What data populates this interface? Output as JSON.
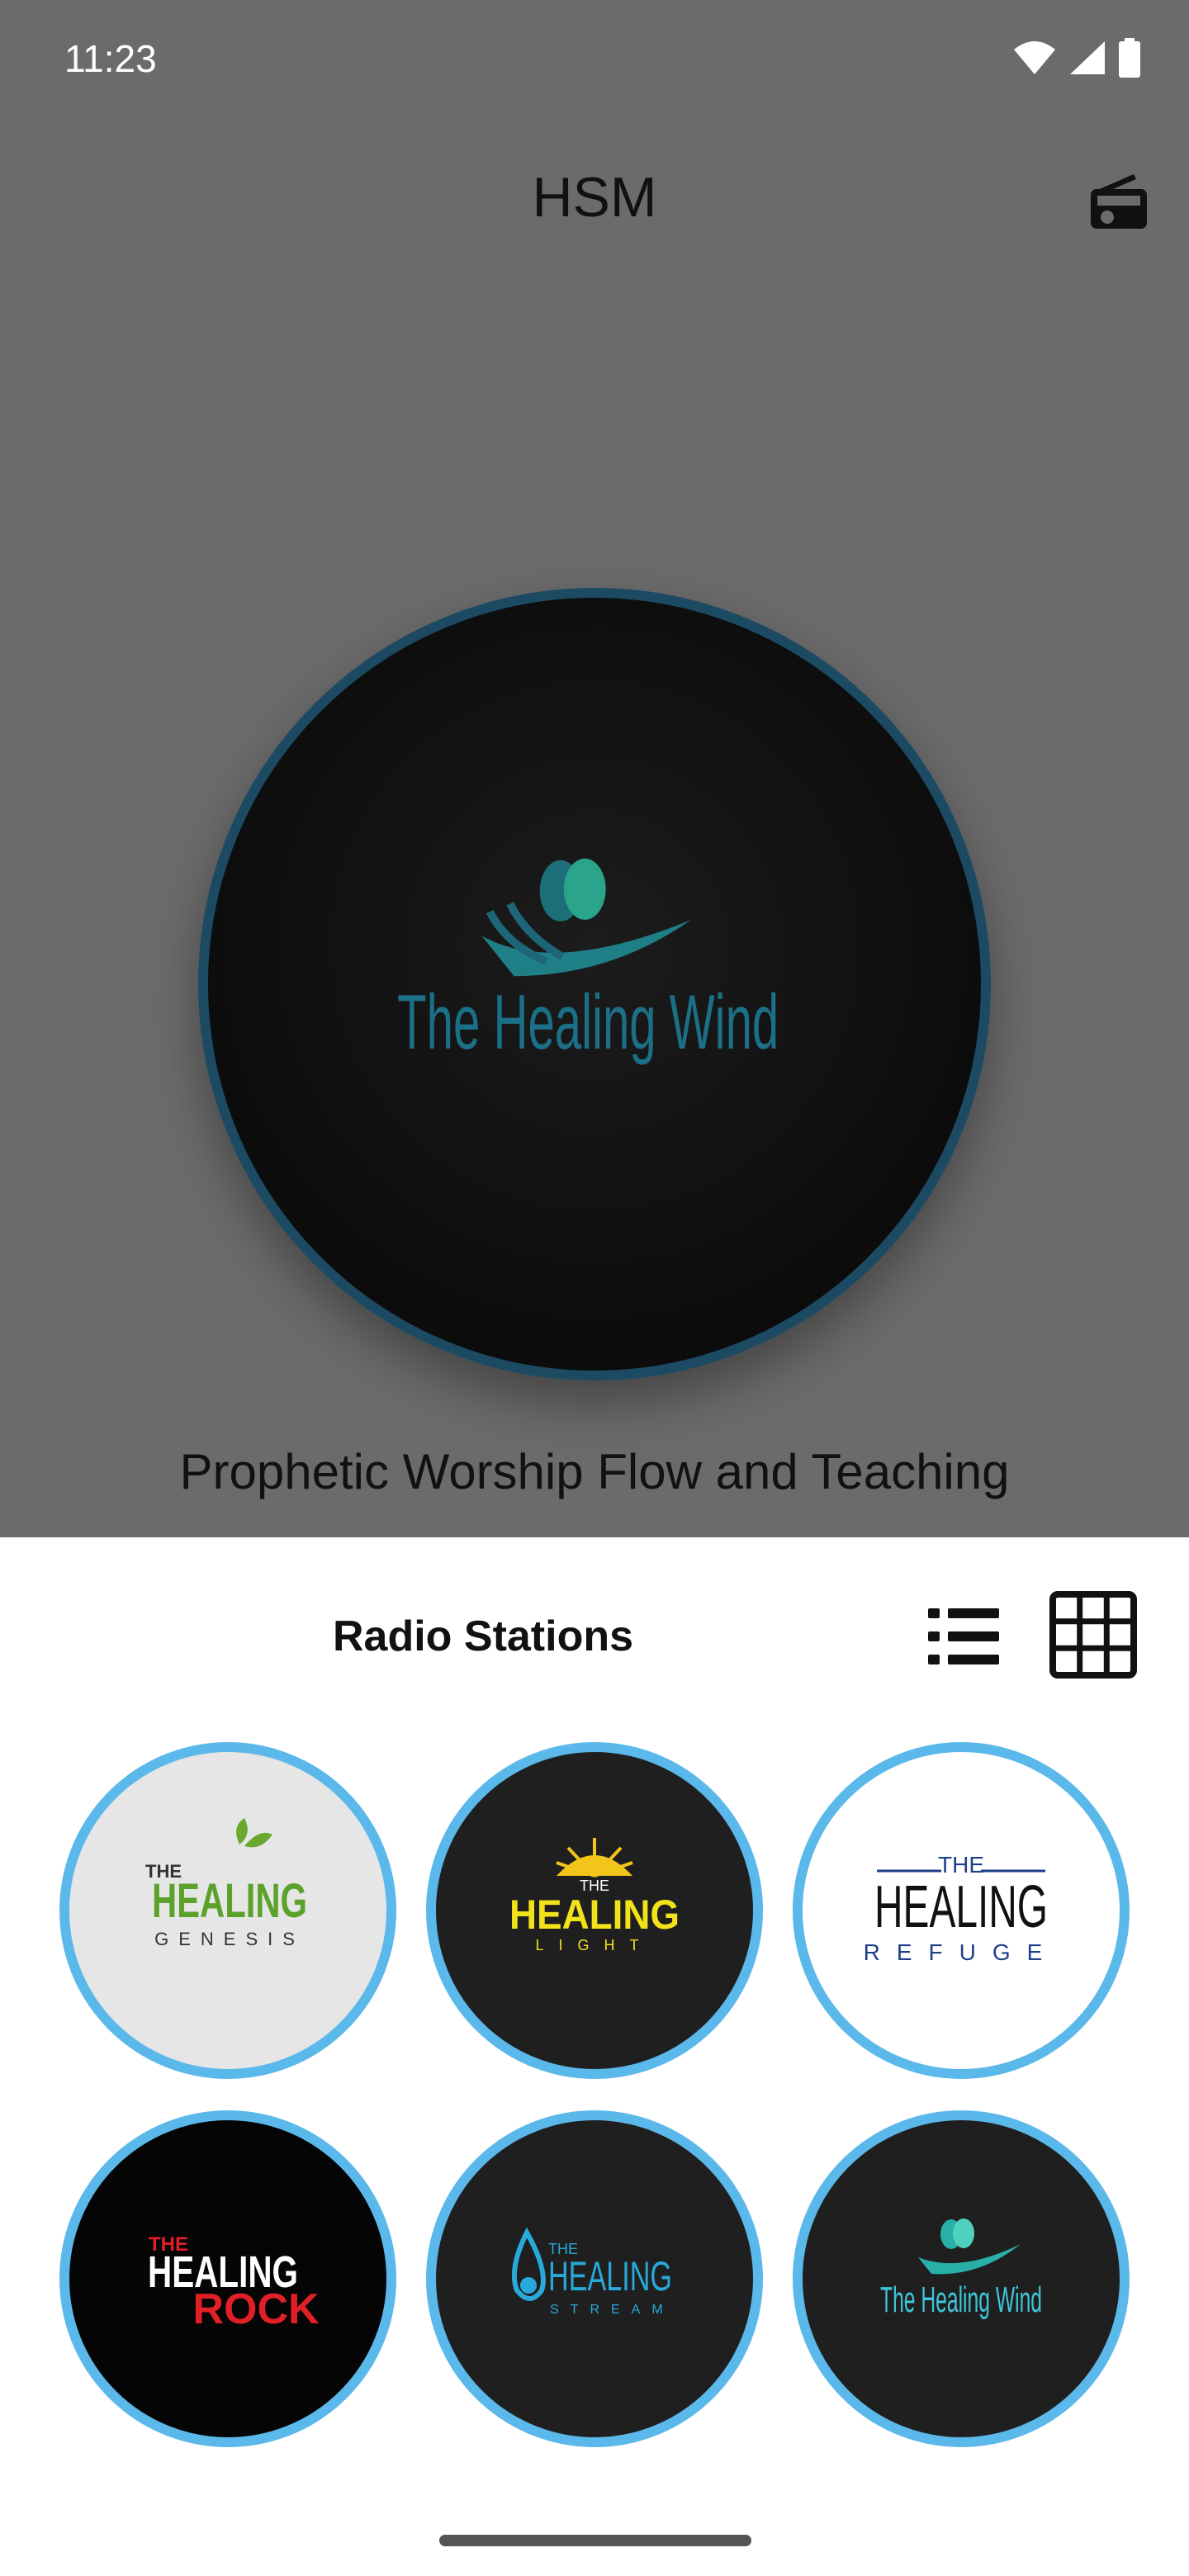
{
  "status_bar": {
    "time": "11:23",
    "icons": [
      "wifi-icon",
      "cellular-signal-icon",
      "battery-icon"
    ]
  },
  "app": {
    "title": "HSM",
    "radio_icon": "radio-icon"
  },
  "now_playing": {
    "logo_text": "The Healing Wind",
    "description": "Prophetic Worship Flow and Teaching"
  },
  "sheet": {
    "title": "Radio Stations",
    "list_view_icon": "list-view-icon",
    "grid_view_icon": "grid-view-icon",
    "stations": [
      {
        "the": "THE",
        "name": "HEALING",
        "sub": "GENESIS"
      },
      {
        "the": "THE",
        "name": "HEALING",
        "sub": "LIGHT"
      },
      {
        "the": "THE",
        "name": "HEALING",
        "sub": "REFUGE"
      },
      {
        "the": "THE",
        "name": "HEALING",
        "sub": "ROCK"
      },
      {
        "the": "THE",
        "name": "HEALING",
        "sub": "STREAM"
      },
      {
        "name": "The Healing Wind"
      }
    ]
  },
  "colors": {
    "accent_ring": "#5bb8ea",
    "overlay": "#6b6b6b",
    "hero_ring": "#1c4a63"
  }
}
